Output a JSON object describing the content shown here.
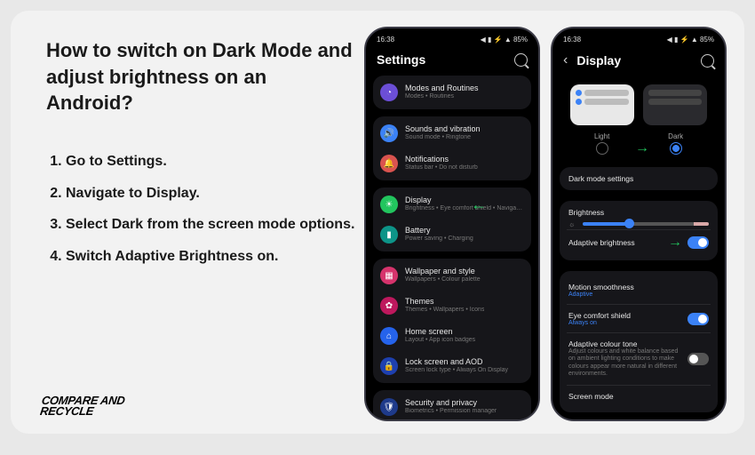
{
  "heading": "How to switch on Dark Mode and adjust brightness on an Android?",
  "steps": [
    "Go to Settings.",
    "Navigate to Display.",
    "Select  Dark from the screen mode options.",
    "Switch Adaptive Brightness on."
  ],
  "logo": {
    "line1": "Compare and",
    "line2": "Recycle"
  },
  "status": {
    "time": "16:38",
    "left_icons": "⬚ ◉ ⦿",
    "right": "◀ ▮ ⚡ ▲ 85%"
  },
  "phone1": {
    "title": "Settings",
    "groups": [
      [
        {
          "title": "Modes and Routines",
          "sub": "Modes • Routines",
          "color": "#6b4ed6",
          "icon": "◔"
        }
      ],
      [
        {
          "title": "Sounds and vibration",
          "sub": "Sound mode • Ringtone",
          "color": "#3b82f6",
          "icon": "🔊"
        },
        {
          "title": "Notifications",
          "sub": "Status bar • Do not disturb",
          "color": "#d9534f",
          "icon": "🔔"
        }
      ],
      [
        {
          "title": "Display",
          "sub": "Brightness • Eye comfort shield • Navigation bar",
          "color": "#22c55e",
          "icon": "☀",
          "arrow": true
        },
        {
          "title": "Battery",
          "sub": "Power saving • Charging",
          "color": "#0d9488",
          "icon": "▮"
        }
      ],
      [
        {
          "title": "Wallpaper and style",
          "sub": "Wallpapers • Colour palette",
          "color": "#d6336c",
          "icon": "▦"
        },
        {
          "title": "Themes",
          "sub": "Themes • Wallpapers • Icons",
          "color": "#be185d",
          "icon": "✿"
        },
        {
          "title": "Home screen",
          "sub": "Layout • App icon badges",
          "color": "#2563eb",
          "icon": "⌂"
        },
        {
          "title": "Lock screen and AOD",
          "sub": "Screen lock type • Always On Display",
          "color": "#1e40af",
          "icon": "🔒"
        }
      ],
      [
        {
          "title": "Security and privacy",
          "sub": "Biometrics • Permission manager",
          "color": "#1e3a8a",
          "icon": "🛡"
        }
      ]
    ]
  },
  "phone2": {
    "title": "Display",
    "theme": {
      "light": "Light",
      "dark": "Dark"
    },
    "dark_mode_settings": "Dark mode settings",
    "brightness": "Brightness",
    "adaptive": "Adaptive brightness",
    "motion": {
      "label": "Motion smoothness",
      "sub": "Adaptive"
    },
    "eye": {
      "label": "Eye comfort shield",
      "sub": "Always on",
      "on": true
    },
    "colortone": {
      "label": "Adaptive colour tone",
      "sub": "Adjust colours and white balance based on ambient lighting conditions to make colours appear more natural in different environments.",
      "on": false
    },
    "screenmode": "Screen mode"
  }
}
